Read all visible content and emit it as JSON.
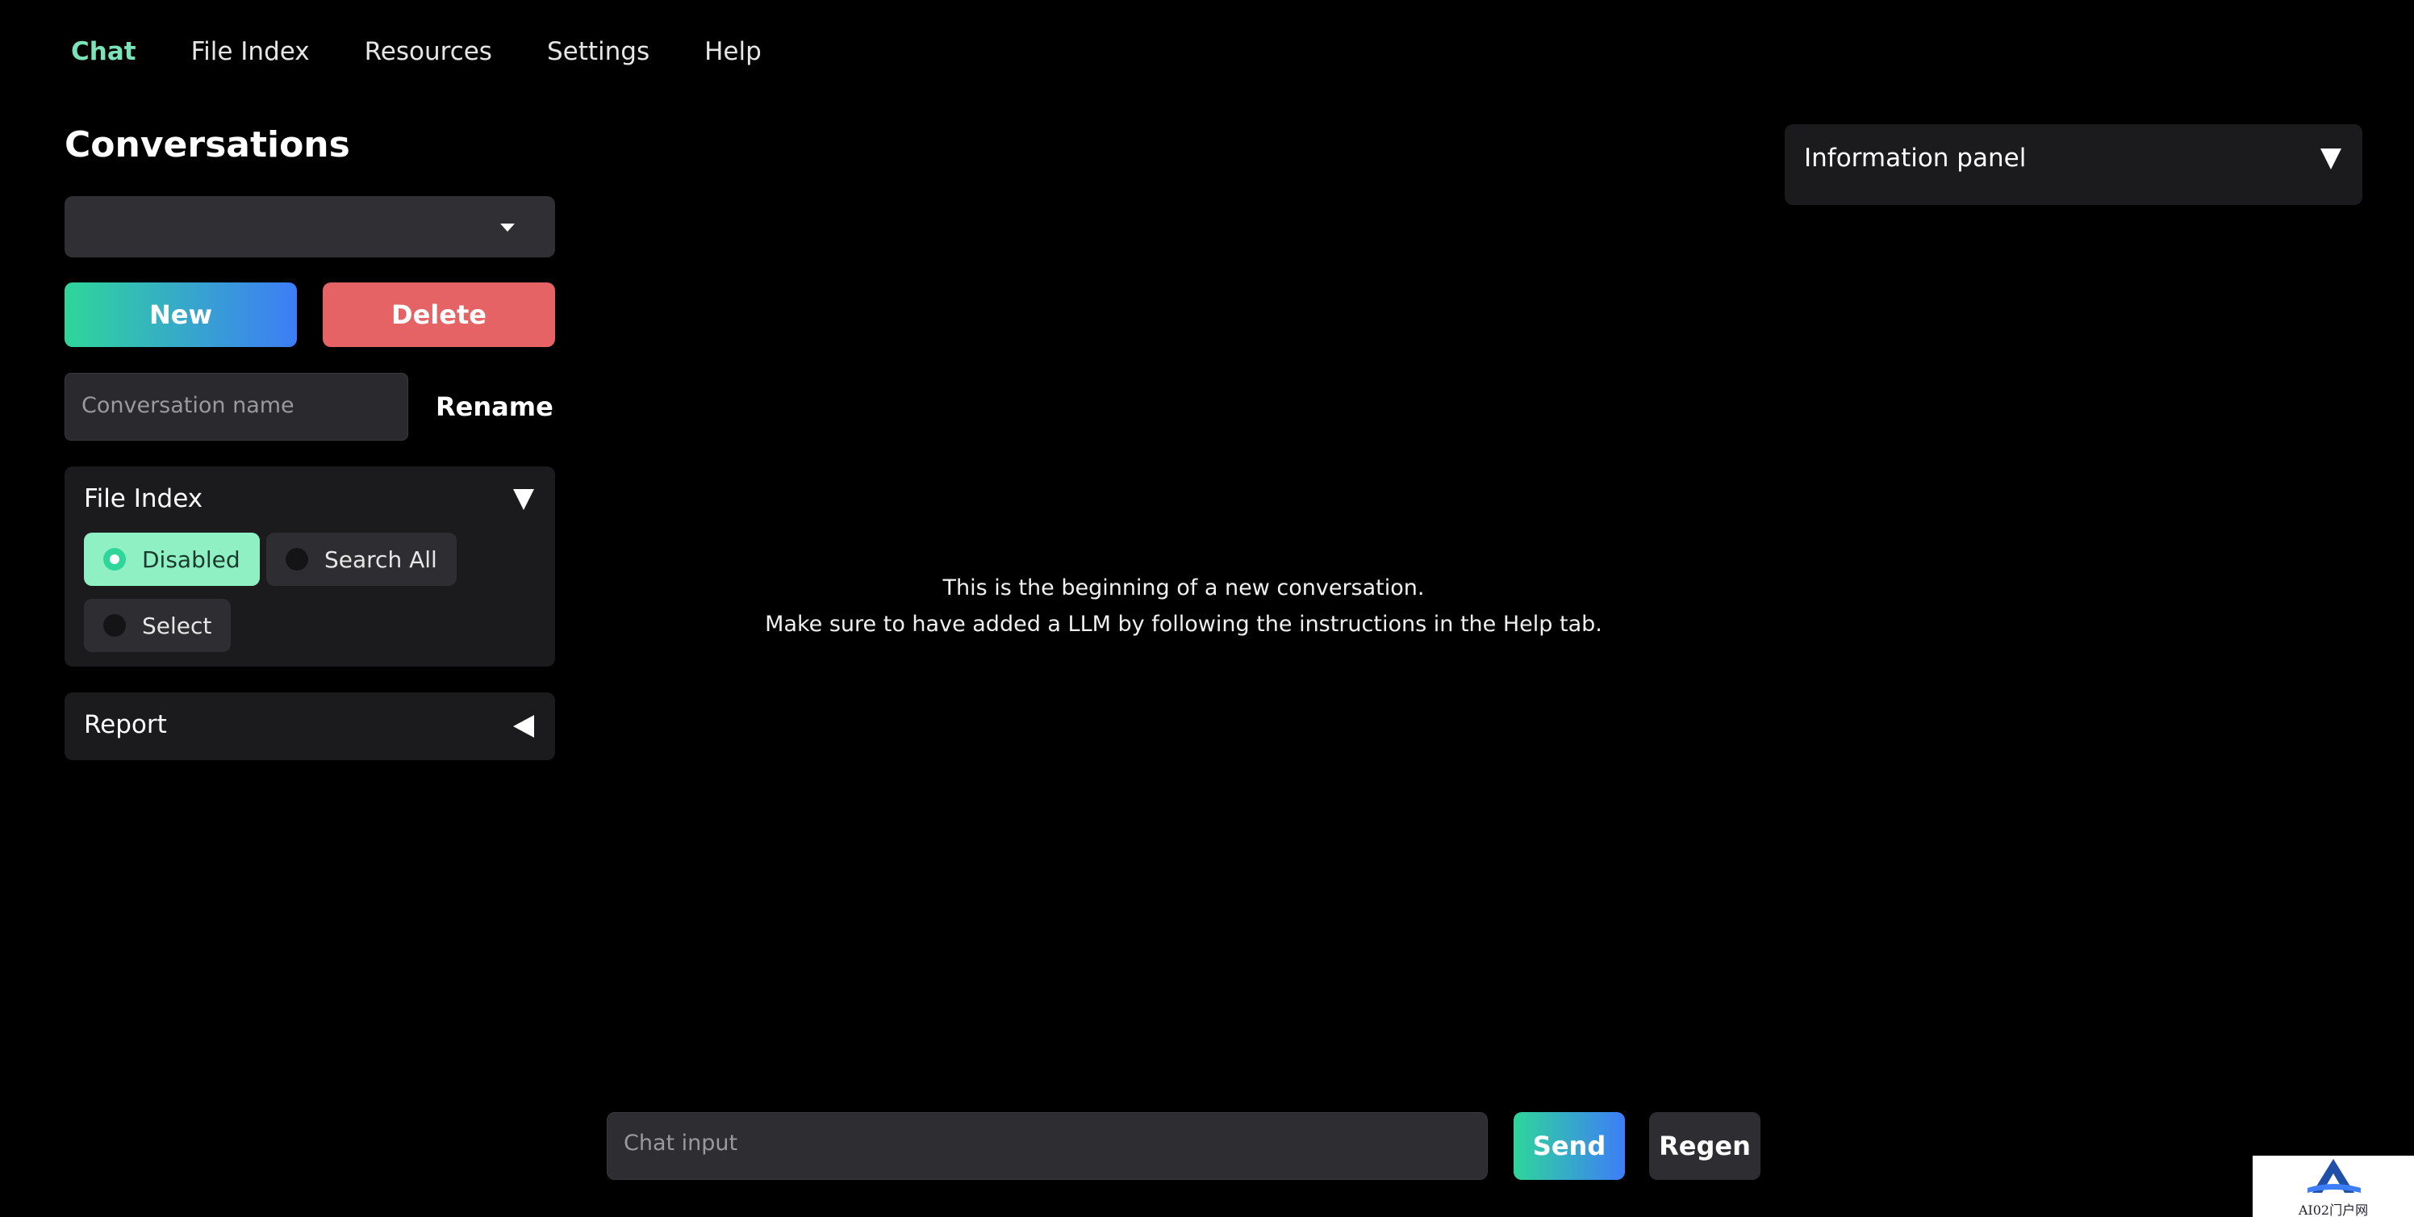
{
  "nav": {
    "tabs": [
      {
        "label": "Chat",
        "active": true
      },
      {
        "label": "File Index"
      },
      {
        "label": "Resources"
      },
      {
        "label": "Settings"
      },
      {
        "label": "Help"
      }
    ]
  },
  "sidebar": {
    "title": "Conversations",
    "conversation_select_value": "",
    "new_label": "New",
    "delete_label": "Delete",
    "conversation_name_placeholder": "Conversation name",
    "rename_label": "Rename",
    "file_index": {
      "title": "File Index",
      "options": [
        {
          "label": "Disabled",
          "selected": true
        },
        {
          "label": "Search All",
          "selected": false
        },
        {
          "label": "Select",
          "selected": false
        }
      ]
    },
    "report": {
      "title": "Report"
    }
  },
  "main": {
    "message_line1": "This is the beginning of a new conversation.",
    "message_line2": "Make sure to have added a LLM by following the instructions in the Help tab."
  },
  "info_panel": {
    "title": "Information panel"
  },
  "chat_bar": {
    "input_placeholder": "Chat input",
    "send_label": "Send",
    "regen_label": "Regen"
  },
  "watermark": {
    "text": "AI02门户网"
  },
  "colors": {
    "accent_green": "#7ce3b8",
    "gradient_start": "#2fd69a",
    "gradient_end": "#3d7df7",
    "delete_red": "#e56265",
    "panel_bg": "#1b1b1e"
  }
}
